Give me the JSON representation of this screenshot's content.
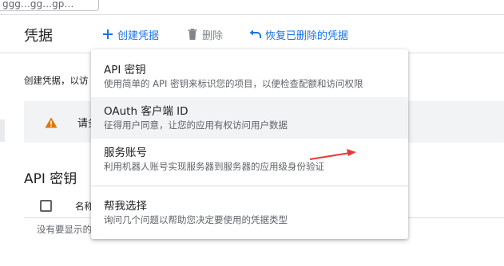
{
  "search": {
    "partial_text": "ggg…gg…gp…"
  },
  "header": {
    "title": "凭据",
    "create_label": "创建凭据",
    "delete_label": "删除",
    "restore_label": "恢复已删除的凭据"
  },
  "page": {
    "intro_text": "创建凭据，以访",
    "warning_text": "请务",
    "section_title": "API 密钥",
    "column_name": "名称",
    "empty_text": "没有要显示的"
  },
  "menu": {
    "items": [
      {
        "title": "API 密钥",
        "desc": "使用简单的 API 密钥来标识您的项目，以便检查配额和访问权限"
      },
      {
        "title": "OAuth 客户端 ID",
        "desc": "征得用户同意，让您的应用有权访问用户数据"
      },
      {
        "title": "服务账号",
        "desc": "利用机器人账号实现服务器到服务器的应用级身份验证"
      },
      {
        "title": "帮我选择",
        "desc": "询问几个问题以帮助您决定要使用的凭据类型"
      }
    ]
  },
  "colors": {
    "accent": "#1a73e8",
    "warning": "#e37400",
    "annotation": "#e53935"
  },
  "icons": [
    "plus-icon",
    "trash-icon",
    "undo-icon",
    "warning-icon"
  ]
}
